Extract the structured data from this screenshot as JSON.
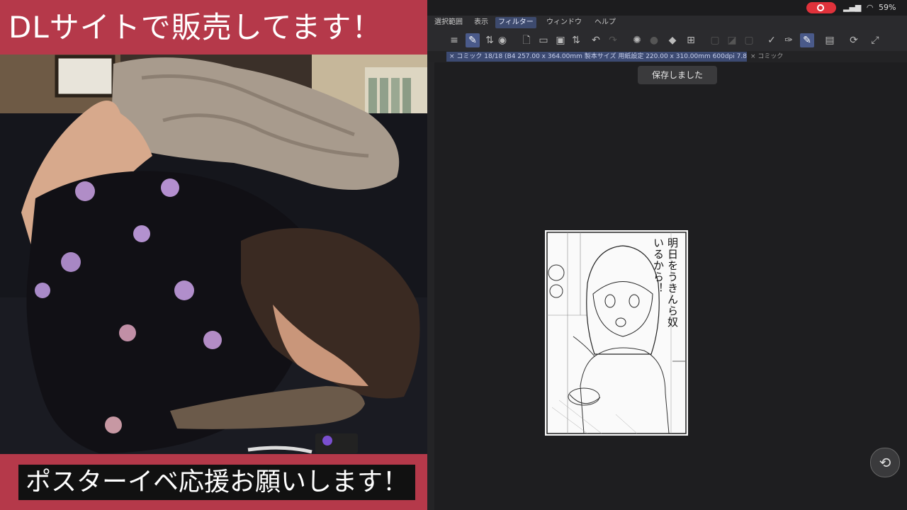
{
  "stream": {
    "top_banner": "DLサイトで販売してます！",
    "bottom_banner": "ポスターイベ応援お願いします！"
  },
  "status": {
    "battery": "59%",
    "wifi_icon": "wifi-icon",
    "signal_icon": "signal-icon"
  },
  "menu": {
    "items": [
      "選択範囲",
      "表示",
      "フィルター",
      "ウィンドウ",
      "ヘルプ"
    ],
    "active": "フィルター"
  },
  "tabs": {
    "active": "× コミック 18/18 (B4 257.00 x 364.00mm 製本サイズ 用紙設定 220.00 x 310.00mm 600dpi 7.8%)",
    "second": "× コミック"
  },
  "toast": "保存しました",
  "manga_page": {
    "col1": "明日をうきんら奴",
    "col2": "いるから！"
  },
  "colors": {
    "banner": "#b5394a",
    "app_bg": "#1c1c1e",
    "accent": "#4a5a8a"
  }
}
